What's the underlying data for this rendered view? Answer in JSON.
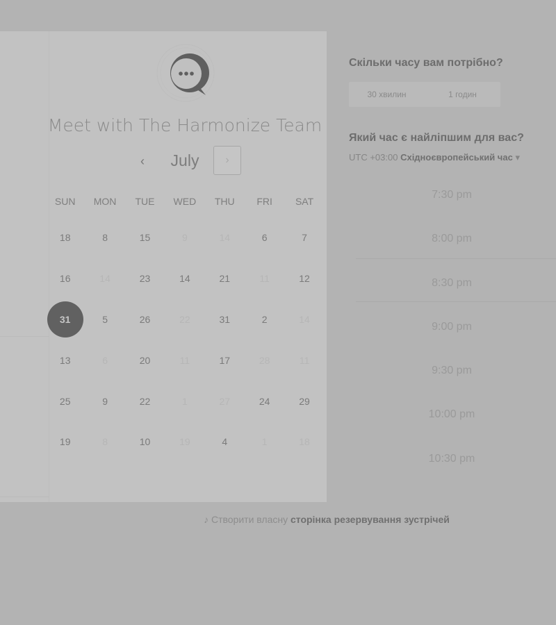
{
  "calendar": {
    "title": "Meet with The Harmonize Team",
    "month": "July",
    "prev_icon": "‹",
    "next_icon": "›",
    "weekdays": [
      "SUN",
      "MON",
      "TUE",
      "WED",
      "THU",
      "FRI",
      "SAT"
    ],
    "weeks": [
      [
        {
          "d": "18",
          "f": false
        },
        {
          "d": "8",
          "f": false
        },
        {
          "d": "15",
          "f": false
        },
        {
          "d": "9",
          "f": true
        },
        {
          "d": "14",
          "f": true
        },
        {
          "d": "6",
          "f": false
        },
        {
          "d": "7",
          "f": false
        }
      ],
      [
        {
          "d": "16",
          "f": false
        },
        {
          "d": "14",
          "f": true
        },
        {
          "d": "23",
          "f": false
        },
        {
          "d": "14",
          "f": false
        },
        {
          "d": "21",
          "f": false
        },
        {
          "d": "11",
          "f": true
        },
        {
          "d": "12",
          "f": false
        }
      ],
      [
        {
          "d": "31",
          "f": false,
          "sel": true
        },
        {
          "d": "5",
          "f": false
        },
        {
          "d": "26",
          "f": false
        },
        {
          "d": "22",
          "f": true
        },
        {
          "d": "31",
          "f": false
        },
        {
          "d": "2",
          "f": false
        },
        {
          "d": "14",
          "f": true
        }
      ],
      [
        {
          "d": "13",
          "f": false
        },
        {
          "d": "6",
          "f": true
        },
        {
          "d": "20",
          "f": false
        },
        {
          "d": "11",
          "f": true
        },
        {
          "d": "17",
          "f": false
        },
        {
          "d": "28",
          "f": true
        },
        {
          "d": "11",
          "f": true
        }
      ],
      [
        {
          "d": "25",
          "f": false
        },
        {
          "d": "9",
          "f": false
        },
        {
          "d": "22",
          "f": false
        },
        {
          "d": "1",
          "f": true
        },
        {
          "d": "27",
          "f": true
        },
        {
          "d": "24",
          "f": false
        },
        {
          "d": "29",
          "f": false
        }
      ],
      [
        {
          "d": "19",
          "f": false
        },
        {
          "d": "8",
          "f": true
        },
        {
          "d": "10",
          "f": false
        },
        {
          "d": "19",
          "f": true
        },
        {
          "d": "4",
          "f": false
        },
        {
          "d": "1",
          "f": true
        },
        {
          "d": "18",
          "f": true
        }
      ]
    ]
  },
  "booking": {
    "duration_question": "Скільки часу вам потрібно?",
    "durations": [
      "30 хвилин",
      "1 годин"
    ],
    "time_question": "Який час є найліпшим для вас?",
    "tz_offset": "UTC +03:00",
    "tz_name": "Східноєвропейський час",
    "tz_caret": "▾",
    "slots": [
      "7:30 pm",
      "8:00 pm",
      "8:30 pm",
      "9:00 pm",
      "9:30 pm",
      "10:00 pm",
      "10:30 pm"
    ]
  },
  "footer": {
    "icon": "♪",
    "text": "Створити власну",
    "link": "сторінка резервування зустрічей"
  }
}
